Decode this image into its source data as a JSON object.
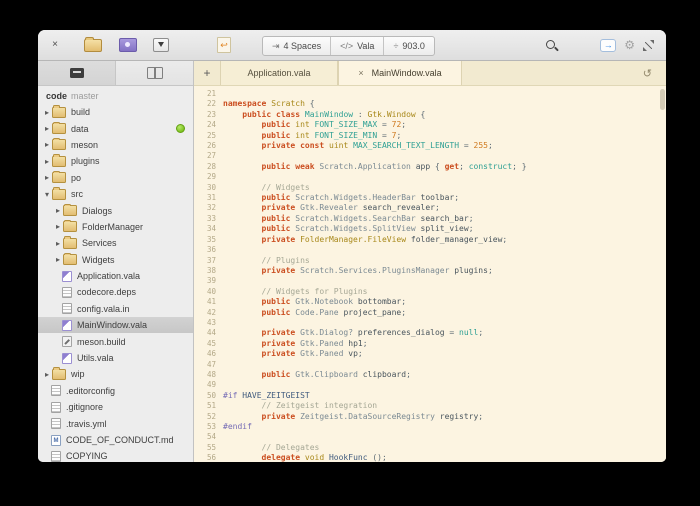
{
  "window": {
    "close_glyph": "×"
  },
  "toolbar": {
    "segments": [
      {
        "icon": "indent-icon",
        "glyph": "⇥",
        "label": "4 Spaces"
      },
      {
        "icon": "code-icon",
        "glyph": "</>",
        "label": "Vala"
      },
      {
        "icon": "goto-line-icon",
        "glyph": "÷",
        "label": "903.0"
      }
    ],
    "revert_glyph": "↩",
    "share_glyph": "→",
    "gear_glyph": "⚙",
    "history_glyph": "↺",
    "new_tab_glyph": "+",
    "tab_close_glyph": "×"
  },
  "sidebar": {
    "project": {
      "name": "code",
      "branch": "master"
    },
    "tree": [
      {
        "label": "build",
        "kind": "folder",
        "depth": 0,
        "expanded": false
      },
      {
        "label": "data",
        "kind": "folder",
        "depth": 0,
        "expanded": false,
        "badge": "green"
      },
      {
        "label": "meson",
        "kind": "folder",
        "depth": 0,
        "expanded": false
      },
      {
        "label": "plugins",
        "kind": "folder",
        "depth": 0,
        "expanded": false
      },
      {
        "label": "po",
        "kind": "folder",
        "depth": 0,
        "expanded": false
      },
      {
        "label": "src",
        "kind": "folder",
        "depth": 0,
        "expanded": true
      },
      {
        "label": "Dialogs",
        "kind": "folder",
        "depth": 1,
        "expanded": false
      },
      {
        "label": "FolderManager",
        "kind": "folder",
        "depth": 1,
        "expanded": false
      },
      {
        "label": "Services",
        "kind": "folder",
        "depth": 1,
        "expanded": false
      },
      {
        "label": "Widgets",
        "kind": "folder",
        "depth": 1,
        "expanded": false
      },
      {
        "label": "Application.vala",
        "kind": "file",
        "icon": "vala",
        "depth": 1
      },
      {
        "label": "codecore.deps",
        "kind": "file",
        "icon": "text",
        "depth": 1
      },
      {
        "label": "config.vala.in",
        "kind": "file",
        "icon": "text",
        "depth": 1
      },
      {
        "label": "MainWindow.vala",
        "kind": "file",
        "icon": "vala",
        "depth": 1,
        "selected": true
      },
      {
        "label": "meson.build",
        "kind": "file",
        "icon": "build",
        "depth": 1
      },
      {
        "label": "Utils.vala",
        "kind": "file",
        "icon": "vala",
        "depth": 1
      },
      {
        "label": "wip",
        "kind": "folder",
        "depth": 0,
        "expanded": false
      },
      {
        "label": ".editorconfig",
        "kind": "file",
        "icon": "text",
        "depth": 0
      },
      {
        "label": ".gitignore",
        "kind": "file",
        "icon": "text",
        "depth": 0
      },
      {
        "label": ".travis.yml",
        "kind": "file",
        "icon": "text",
        "depth": 0
      },
      {
        "label": "CODE_OF_CONDUCT.md",
        "kind": "file",
        "icon": "md",
        "depth": 0
      },
      {
        "label": "COPYING",
        "kind": "file",
        "icon": "text",
        "depth": 0
      }
    ]
  },
  "tabs": {
    "items": [
      {
        "label": "Application.vala",
        "active": false
      },
      {
        "label": "MainWindow.vala",
        "active": true
      }
    ]
  },
  "editor": {
    "first_line": 21,
    "last_line": 56,
    "lines": [
      [],
      [
        [
          "k",
          "namespace"
        ],
        [
          "p",
          " "
        ],
        [
          "t",
          "Scratch"
        ],
        [
          "p",
          " {"
        ]
      ],
      [
        [
          "p",
          "    "
        ],
        [
          "k",
          "public"
        ],
        [
          "p",
          " "
        ],
        [
          "k",
          "class"
        ],
        [
          "p",
          " "
        ],
        [
          "c",
          "MainWindow"
        ],
        [
          "p",
          " : "
        ],
        [
          "t",
          "Gtk.Window"
        ],
        [
          "p",
          " {"
        ]
      ],
      [
        [
          "p",
          "        "
        ],
        [
          "k",
          "public"
        ],
        [
          "p",
          " "
        ],
        [
          "t",
          "int"
        ],
        [
          "p",
          " "
        ],
        [
          "c",
          "FONT_SIZE_MAX"
        ],
        [
          "p",
          " = "
        ],
        [
          "n",
          "72"
        ],
        [
          "p",
          ";"
        ]
      ],
      [
        [
          "p",
          "        "
        ],
        [
          "k",
          "public"
        ],
        [
          "p",
          " "
        ],
        [
          "t",
          "int"
        ],
        [
          "p",
          " "
        ],
        [
          "c",
          "FONT_SIZE_MIN"
        ],
        [
          "p",
          " = "
        ],
        [
          "n",
          "7"
        ],
        [
          "p",
          ";"
        ]
      ],
      [
        [
          "p",
          "        "
        ],
        [
          "k",
          "private"
        ],
        [
          "p",
          " "
        ],
        [
          "k",
          "const"
        ],
        [
          "p",
          " "
        ],
        [
          "t",
          "uint"
        ],
        [
          "p",
          " "
        ],
        [
          "c",
          "MAX_SEARCH_TEXT_LENGTH"
        ],
        [
          "p",
          " = "
        ],
        [
          "n",
          "255"
        ],
        [
          "p",
          ";"
        ]
      ],
      [],
      [
        [
          "p",
          "        "
        ],
        [
          "k",
          "public"
        ],
        [
          "p",
          " "
        ],
        [
          "k",
          "weak"
        ],
        [
          "p",
          " "
        ],
        [
          "g",
          "Scratch.Application"
        ],
        [
          "p",
          " "
        ],
        [
          "i",
          "app"
        ],
        [
          "p",
          " { "
        ],
        [
          "k",
          "get"
        ],
        [
          "p",
          "; "
        ],
        [
          "c",
          "construct"
        ],
        [
          "p",
          "; }"
        ]
      ],
      [],
      [
        [
          "p",
          "        "
        ],
        [
          "m",
          "// Widgets"
        ]
      ],
      [
        [
          "p",
          "        "
        ],
        [
          "k",
          "public"
        ],
        [
          "p",
          " "
        ],
        [
          "g",
          "Scratch.Widgets.HeaderBar"
        ],
        [
          "p",
          " "
        ],
        [
          "i",
          "toolbar"
        ],
        [
          "p",
          ";"
        ]
      ],
      [
        [
          "p",
          "        "
        ],
        [
          "k",
          "private"
        ],
        [
          "p",
          " "
        ],
        [
          "g",
          "Gtk.Revealer"
        ],
        [
          "p",
          " "
        ],
        [
          "i",
          "search_revealer"
        ],
        [
          "p",
          ";"
        ]
      ],
      [
        [
          "p",
          "        "
        ],
        [
          "k",
          "public"
        ],
        [
          "p",
          " "
        ],
        [
          "g",
          "Scratch.Widgets.SearchBar"
        ],
        [
          "p",
          " "
        ],
        [
          "i",
          "search_bar"
        ],
        [
          "p",
          ";"
        ]
      ],
      [
        [
          "p",
          "        "
        ],
        [
          "k",
          "public"
        ],
        [
          "p",
          " "
        ],
        [
          "g",
          "Scratch.Widgets.SplitView"
        ],
        [
          "p",
          " "
        ],
        [
          "i",
          "split_view"
        ],
        [
          "p",
          ";"
        ]
      ],
      [
        [
          "p",
          "        "
        ],
        [
          "k",
          "private"
        ],
        [
          "p",
          " "
        ],
        [
          "t",
          "FolderManager.FileView"
        ],
        [
          "p",
          " "
        ],
        [
          "i",
          "folder_manager_view"
        ],
        [
          "p",
          ";"
        ]
      ],
      [],
      [
        [
          "p",
          "        "
        ],
        [
          "m",
          "// Plugins"
        ]
      ],
      [
        [
          "p",
          "        "
        ],
        [
          "k",
          "private"
        ],
        [
          "p",
          " "
        ],
        [
          "g",
          "Scratch.Services.PluginsManager"
        ],
        [
          "p",
          " "
        ],
        [
          "i",
          "plugins"
        ],
        [
          "p",
          ";"
        ]
      ],
      [],
      [
        [
          "p",
          "        "
        ],
        [
          "m",
          "// Widgets for Plugins"
        ]
      ],
      [
        [
          "p",
          "        "
        ],
        [
          "k",
          "public"
        ],
        [
          "p",
          " "
        ],
        [
          "g",
          "Gtk.Notebook"
        ],
        [
          "p",
          " "
        ],
        [
          "i",
          "bottombar"
        ],
        [
          "p",
          ";"
        ]
      ],
      [
        [
          "p",
          "        "
        ],
        [
          "k",
          "public"
        ],
        [
          "p",
          " "
        ],
        [
          "g",
          "Code.Pane"
        ],
        [
          "p",
          " "
        ],
        [
          "i",
          "project_pane"
        ],
        [
          "p",
          ";"
        ]
      ],
      [],
      [
        [
          "p",
          "        "
        ],
        [
          "k",
          "private"
        ],
        [
          "p",
          " "
        ],
        [
          "g",
          "Gtk.Dialog?"
        ],
        [
          "p",
          " "
        ],
        [
          "i",
          "preferences_dialog"
        ],
        [
          "p",
          " = "
        ],
        [
          "c",
          "null"
        ],
        [
          "p",
          ";"
        ]
      ],
      [
        [
          "p",
          "        "
        ],
        [
          "k",
          "private"
        ],
        [
          "p",
          " "
        ],
        [
          "g",
          "Gtk.Paned"
        ],
        [
          "p",
          " "
        ],
        [
          "i",
          "hp1"
        ],
        [
          "p",
          ";"
        ]
      ],
      [
        [
          "p",
          "        "
        ],
        [
          "k",
          "private"
        ],
        [
          "p",
          " "
        ],
        [
          "g",
          "Gtk.Paned"
        ],
        [
          "p",
          " "
        ],
        [
          "i",
          "vp"
        ],
        [
          "p",
          ";"
        ]
      ],
      [],
      [
        [
          "p",
          "        "
        ],
        [
          "k",
          "public"
        ],
        [
          "p",
          " "
        ],
        [
          "g",
          "Gtk.Clipboard"
        ],
        [
          "p",
          " "
        ],
        [
          "i",
          "clipboard"
        ],
        [
          "p",
          ";"
        ]
      ],
      [],
      [
        [
          "d",
          "#if"
        ],
        [
          "p",
          " "
        ],
        [
          "f",
          "HAVE_ZEITGEIST"
        ]
      ],
      [
        [
          "p",
          "        "
        ],
        [
          "m",
          "// Zeitgeist integration"
        ]
      ],
      [
        [
          "p",
          "        "
        ],
        [
          "k",
          "private"
        ],
        [
          "p",
          " "
        ],
        [
          "g",
          "Zeitgeist.DataSourceRegistry"
        ],
        [
          "p",
          " "
        ],
        [
          "i",
          "registry"
        ],
        [
          "p",
          ";"
        ]
      ],
      [
        [
          "d",
          "#endif"
        ]
      ],
      [],
      [
        [
          "p",
          "        "
        ],
        [
          "m",
          "// Delegates"
        ]
      ],
      [
        [
          "p",
          "        "
        ],
        [
          "k",
          "delegate"
        ],
        [
          "p",
          " "
        ],
        [
          "t",
          "void"
        ],
        [
          "p",
          " "
        ],
        [
          "f",
          "HookFunc"
        ],
        [
          "p",
          " ();"
        ]
      ]
    ]
  },
  "colors": {
    "accent": "#3689e6",
    "badge_green": "#7ec322",
    "folder_tan": "#e9c27b",
    "editor_bg": "#fcf4e1",
    "keyword": "#cb4f21",
    "type": "#a8881a",
    "constant": "#2fa094",
    "comment": "#a5a795",
    "preprocessor": "#756bb5"
  }
}
